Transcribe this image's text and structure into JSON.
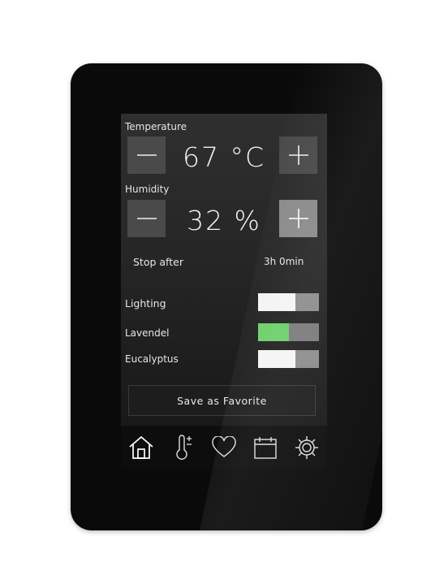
{
  "temperature": {
    "label": "Temperature",
    "value": "67 °C",
    "minus_icon": "minus-icon",
    "plus_icon": "plus-icon"
  },
  "humidity": {
    "label": "Humidity",
    "value": "32 %",
    "minus_icon": "minus-icon",
    "plus_icon": "plus-icon"
  },
  "timer": {
    "label": "Stop after",
    "value": "3h 0min"
  },
  "toggles": [
    {
      "label": "Lighting",
      "state": "on",
      "color": "#f4f4f4"
    },
    {
      "label": "Lavendel",
      "state": "on",
      "color": "#6ccf6a"
    },
    {
      "label": "Eucalyptus",
      "state": "on",
      "color": "#f4f4f4"
    }
  ],
  "favorite_button": {
    "label": "Save as Favorite"
  },
  "nav": [
    {
      "icon": "home-icon"
    },
    {
      "icon": "thermometer-icon"
    },
    {
      "icon": "heart-icon"
    },
    {
      "icon": "calendar-icon"
    },
    {
      "icon": "settings-gear-icon"
    }
  ]
}
